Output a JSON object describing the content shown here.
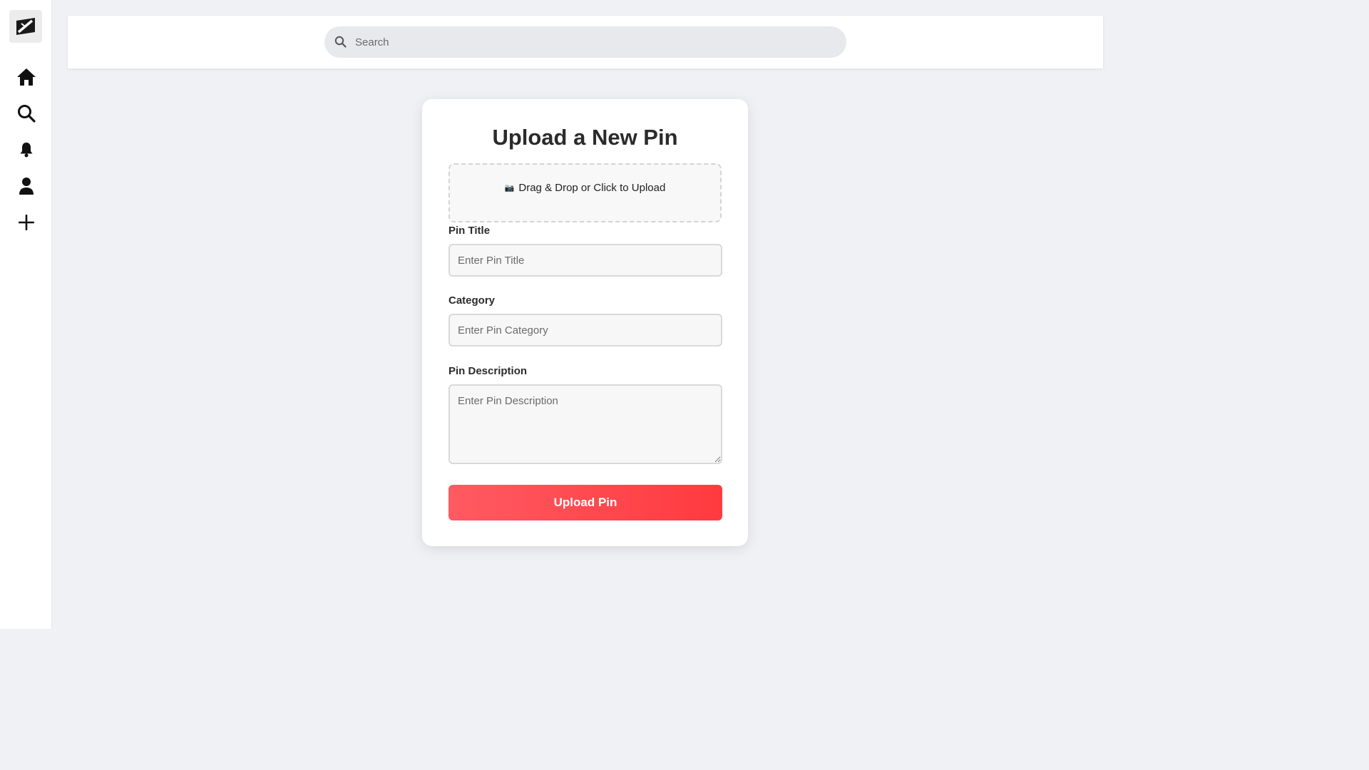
{
  "sidebar": {
    "logo": "app-logo",
    "items": [
      {
        "name": "home",
        "icon": "home-icon"
      },
      {
        "name": "search",
        "icon": "search-icon"
      },
      {
        "name": "notifications",
        "icon": "bell-icon"
      },
      {
        "name": "profile",
        "icon": "user-icon"
      },
      {
        "name": "create",
        "icon": "plus-icon"
      }
    ]
  },
  "header": {
    "search_placeholder": "Search"
  },
  "upload_form": {
    "title": "Upload a New Pin",
    "dropzone_icon": "📷",
    "dropzone_text": "Drag & Drop or Click to Upload",
    "title_label": "Pin Title",
    "title_placeholder": "Enter Pin Title",
    "category_label": "Category",
    "category_placeholder": "Enter Pin Category",
    "description_label": "Pin Description",
    "description_placeholder": "Enter Pin Description",
    "submit_label": "Upload Pin"
  },
  "colors": {
    "accent_start": "#ff5a62",
    "accent_end": "#ff3a3f",
    "background": "#f0f1f5"
  }
}
